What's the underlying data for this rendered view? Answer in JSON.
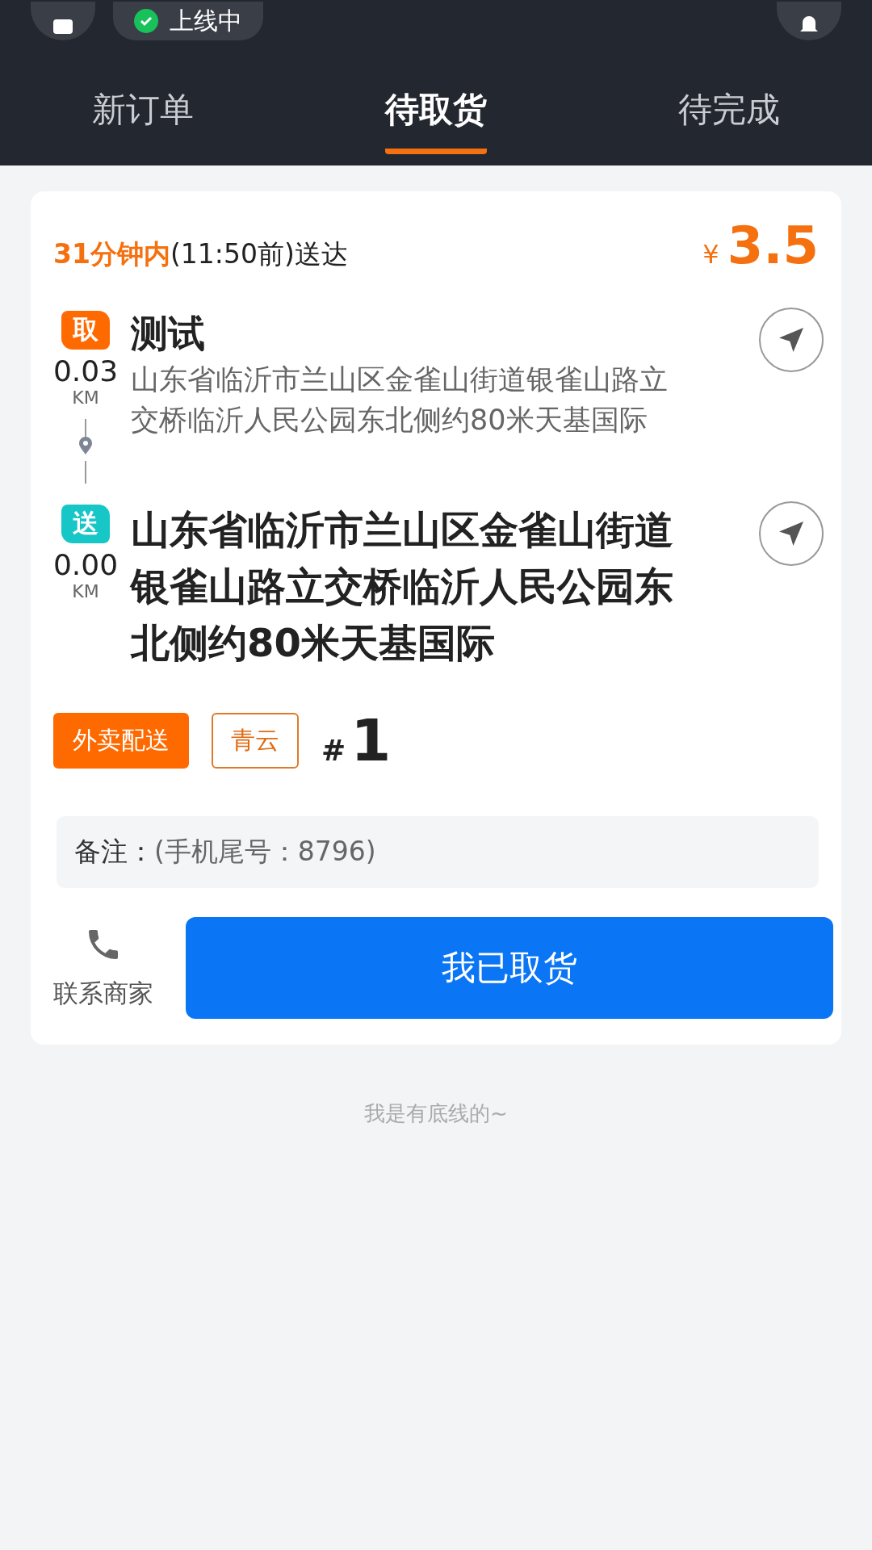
{
  "status_bar": {
    "status": "上线中"
  },
  "tabs": [
    {
      "label": "新订单",
      "selected": false
    },
    {
      "label": "待取货",
      "selected": true
    },
    {
      "label": "待完成",
      "selected": false
    }
  ],
  "order": {
    "deadline": "**31分钟内**(11:50前)送达",
    "currency": "¥",
    "price": "3.5",
    "stops": [
      {
        "kind": "pickup",
        "badge": "取",
        "distance": "0.03",
        "unit": "KM",
        "name": "测试",
        "address": "山东省临沂市兰山区金雀山街道银雀山路立交桥临沂人民公园东北侧约80米天基国际"
      },
      {
        "kind": "dropoff",
        "badge": "送",
        "distance": "0.00",
        "unit": "KM",
        "address": "山东省临沂市兰山区金雀山街道银雀山路立交桥临沂人民公园东北侧约80米天基国际"
      }
    ],
    "tags": [
      {
        "kind": "filled",
        "label": "外卖配送"
      },
      {
        "kind": "outlined",
        "label": "青云"
      }
    ],
    "number_sign": "#",
    "number": "1",
    "note_label": "备注：",
    "note": "(手机尾号：8796)",
    "contact": "联系商家",
    "primary_button": "我已取货"
  },
  "footer": "我是有底线的~"
}
